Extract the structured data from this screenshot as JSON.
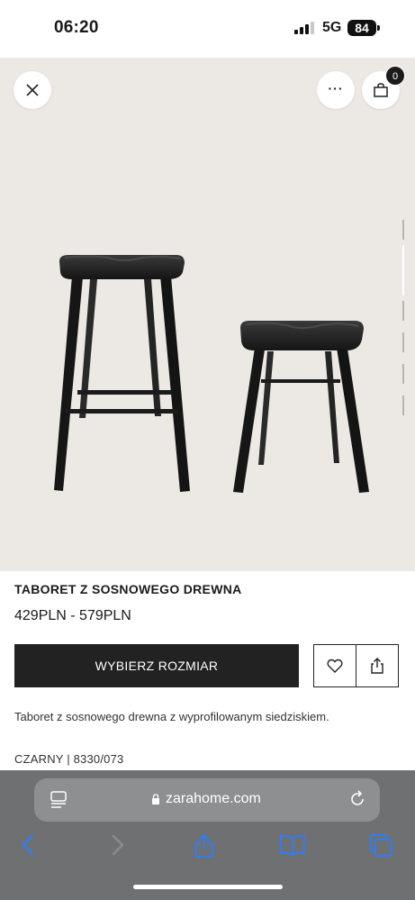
{
  "status_bar": {
    "time": "06:20",
    "network": "5G",
    "battery": "84"
  },
  "hero": {
    "close_icon": "close-icon",
    "more_label": "···",
    "bag_icon": "shopping-bag-icon",
    "bag_count": "0"
  },
  "product": {
    "title": "TABORET Z SOSNOWEGO DREWNA",
    "price": "429PLN - 579PLN",
    "select_size_label": "WYBIERZ ROZMIAR",
    "description": "Taboret z sosnowego drewna z wyprofilowanym siedziskiem.",
    "color_ref": "CZARNY | 8330/073"
  },
  "browser": {
    "url": "zarahome.com"
  },
  "colors": {
    "hero_bg": "#ece8e4",
    "button_dark": "#222222",
    "browser_bar": "#6f7072",
    "url_field": "#8e8f91",
    "nav_blue": "#2f7cf6"
  }
}
